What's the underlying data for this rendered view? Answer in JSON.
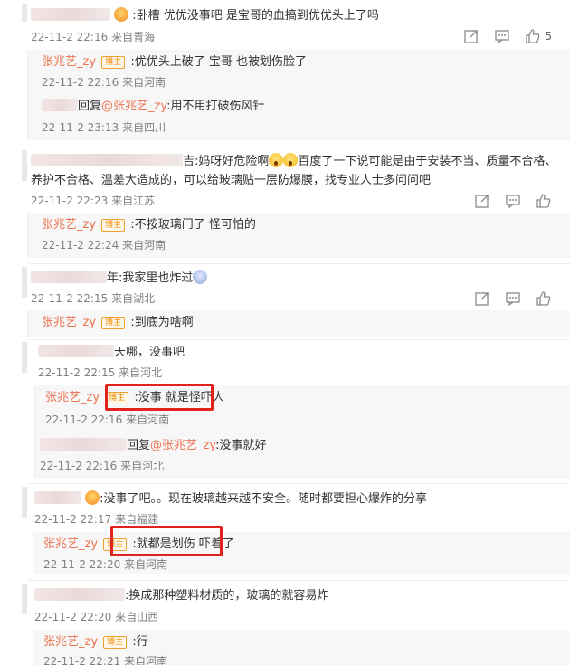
{
  "comments": [
    {
      "text": ":卧槽 优优没事吧 是宝哥的血搞到优优头上了吗",
      "time": "22-11-2 22:16",
      "location": "来自青海",
      "likes": "5",
      "replies": [
        {
          "user": "张兆艺_zy",
          "badge": "博主",
          "text": ":优优头上破了 宝哥 也被划伤脸了",
          "time": "22-11-2 22:16",
          "location": "来自河南"
        },
        {
          "reply_prefix": "回复",
          "mention": "@张兆艺_zy",
          "text": ":用不用打破伤风针",
          "time": "22-11-2 23:13",
          "location": "来自四川"
        }
      ]
    },
    {
      "name_tail": "吉",
      "text_a": ":妈呀好危险啊",
      "text_b": "百度了一下说可能是由于安装不当、质量不合格、",
      "text_c": "养护不合格、温差大造成的，可以给玻璃贴一层防爆膜，找专业人士多问问吧",
      "time": "22-11-2 22:23",
      "location": "来自江苏",
      "replies": [
        {
          "user": "张兆艺_zy",
          "badge": "博主",
          "text": ":不按玻璃门了 怪可怕的",
          "time": "22-11-2 22:24",
          "location": "来自河南"
        }
      ]
    },
    {
      "name_tail": "年",
      "text": ":我家里也炸过",
      "time": "22-11-2 22:15",
      "location": "来自湖北",
      "replies": [
        {
          "user": "张兆艺_zy",
          "badge": "博主",
          "text": ":到底为啥啊",
          "time": "",
          "location": ""
        }
      ]
    },
    {
      "text": "天哪，没事吧",
      "time": "22-11-2 22:15",
      "location": "来自河北",
      "replies": [
        {
          "user": "张兆艺_zy",
          "badge": "博主",
          "text": ":没事 就是怪吓人",
          "time": "22-11-2 22:16",
          "location": "来自河南"
        },
        {
          "reply_prefix": "回复",
          "mention": "@张兆艺_zy",
          "text": ":没事就好",
          "time": "22-11-2 22:16",
          "location": "来自河北"
        }
      ]
    },
    {
      "text": ":没事了吧。。现在玻璃越来越不安全。随时都要担心爆炸的分享",
      "time": "22-11-2 22:17",
      "location": "来自福建",
      "replies": [
        {
          "user": "张兆艺_zy",
          "badge": "博主",
          "text": ":就都是划伤 吓着了",
          "time": "22-11-2 22:20",
          "location": "来自河南"
        }
      ]
    },
    {
      "text": ":换成那种塑料材质的，玻璃的就容易炸",
      "time": "22-11-2 22:20",
      "location": "来自山西",
      "replies": [
        {
          "user": "张兆艺_zy",
          "badge": "博主",
          "text": ":行",
          "time": "22-11-2 22:21",
          "location": "来自河南"
        }
      ]
    }
  ],
  "colors": {
    "username": "#eb7350",
    "meta": "#808080",
    "highlight": "#e0231c",
    "reply_bg": "#f7f7f7"
  },
  "icons": [
    "share-icon",
    "comment-icon",
    "like-icon"
  ]
}
